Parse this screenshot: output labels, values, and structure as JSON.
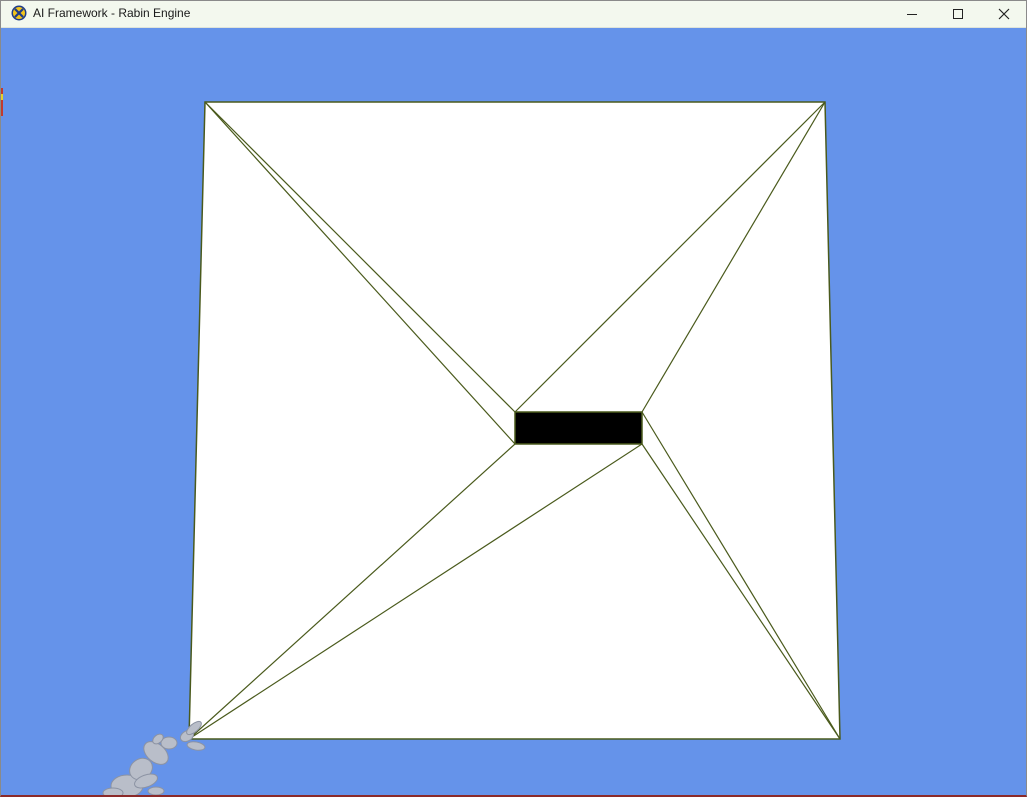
{
  "window": {
    "title": "AI Framework - Rabin Engine",
    "app_icon": "rabin-engine-icon",
    "controls": {
      "minimize_icon": "minimize-icon",
      "maximize_icon": "maximize-icon",
      "close_icon": "close-icon"
    }
  },
  "scene": {
    "background_color": "#6593ea",
    "floor_color": "#ffffff",
    "edge_color": "#4a5a1c",
    "obstacle_color": "#000000",
    "agent": "agent-figure"
  }
}
